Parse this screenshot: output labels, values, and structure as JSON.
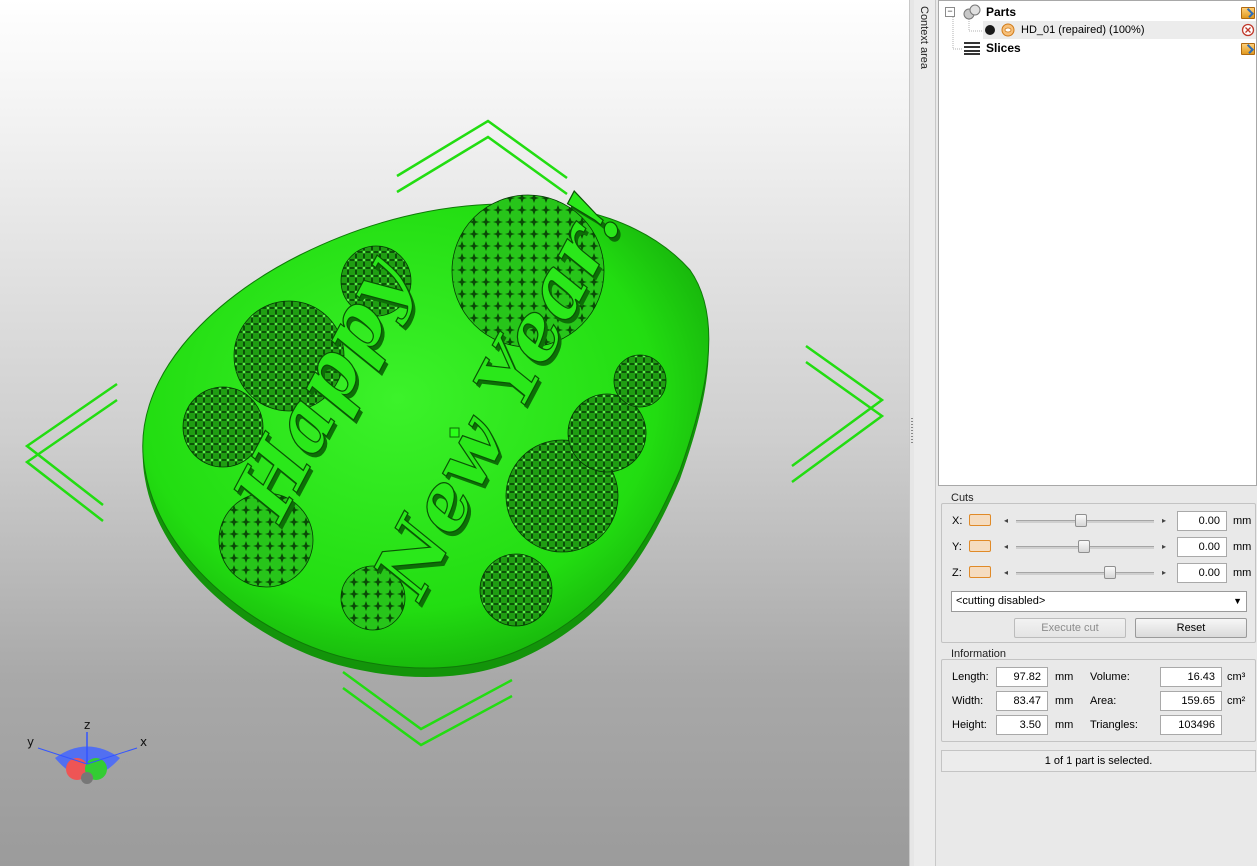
{
  "viewport": {
    "model_color": "#22dd11",
    "embossed_text": [
      "Happy",
      "New Year!"
    ],
    "axes": {
      "x": "x",
      "y": "y",
      "z": "z"
    }
  },
  "context_tab": {
    "label": "Context area"
  },
  "tree": {
    "parts_label": "Parts",
    "part_item": "HD_01 (repaired) (100%)",
    "slices_label": "Slices"
  },
  "cuts": {
    "title": "Cuts",
    "rows": [
      {
        "axis": "X:",
        "value": "0.00",
        "unit": "mm",
        "slider": 0.48
      },
      {
        "axis": "Y:",
        "value": "0.00",
        "unit": "mm",
        "slider": 0.5
      },
      {
        "axis": "Z:",
        "value": "0.00",
        "unit": "mm",
        "slider": 0.78
      }
    ],
    "mode_selected": "<cutting disabled>",
    "execute_label": "Execute cut",
    "reset_label": "Reset"
  },
  "information": {
    "title": "Information",
    "length_label": "Length:",
    "length_value": "97.82",
    "length_unit": "mm",
    "width_label": "Width:",
    "width_value": "83.47",
    "width_unit": "mm",
    "height_label": "Height:",
    "height_value": "3.50",
    "height_unit": "mm",
    "volume_label": "Volume:",
    "volume_value": "16.43",
    "volume_unit": "cm³",
    "area_label": "Area:",
    "area_value": "159.65",
    "area_unit": "cm²",
    "triangles_label": "Triangles:",
    "triangles_value": "103496"
  },
  "status": {
    "text": "1 of 1 part is selected."
  }
}
